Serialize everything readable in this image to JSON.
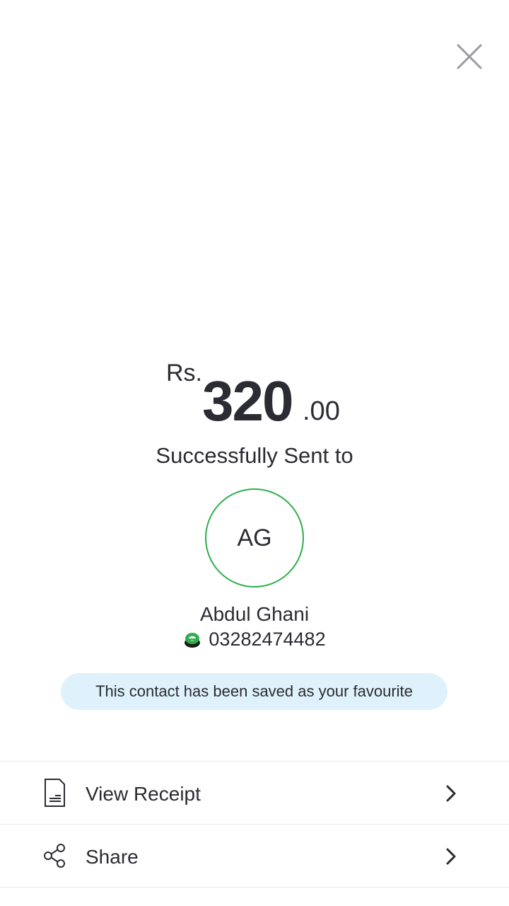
{
  "header": {
    "close_icon": "close-icon"
  },
  "amount": {
    "currency": "Rs.",
    "whole": "320",
    "fraction": ".00"
  },
  "status_text": "Successfully Sent to",
  "recipient": {
    "initials": "AG",
    "name": "Abdul Ghani",
    "phone": "03282474482",
    "provider_icon": "easypaisa-logo-icon"
  },
  "favourite_banner": "This contact has been saved as your favourite",
  "actions": [
    {
      "label": "View Receipt",
      "icon": "receipt-icon"
    },
    {
      "label": "Share",
      "icon": "share-icon"
    }
  ],
  "colors": {
    "avatar_border": "#2fae4e",
    "banner_bg": "#dff2fb",
    "text": "#2b2b33"
  }
}
